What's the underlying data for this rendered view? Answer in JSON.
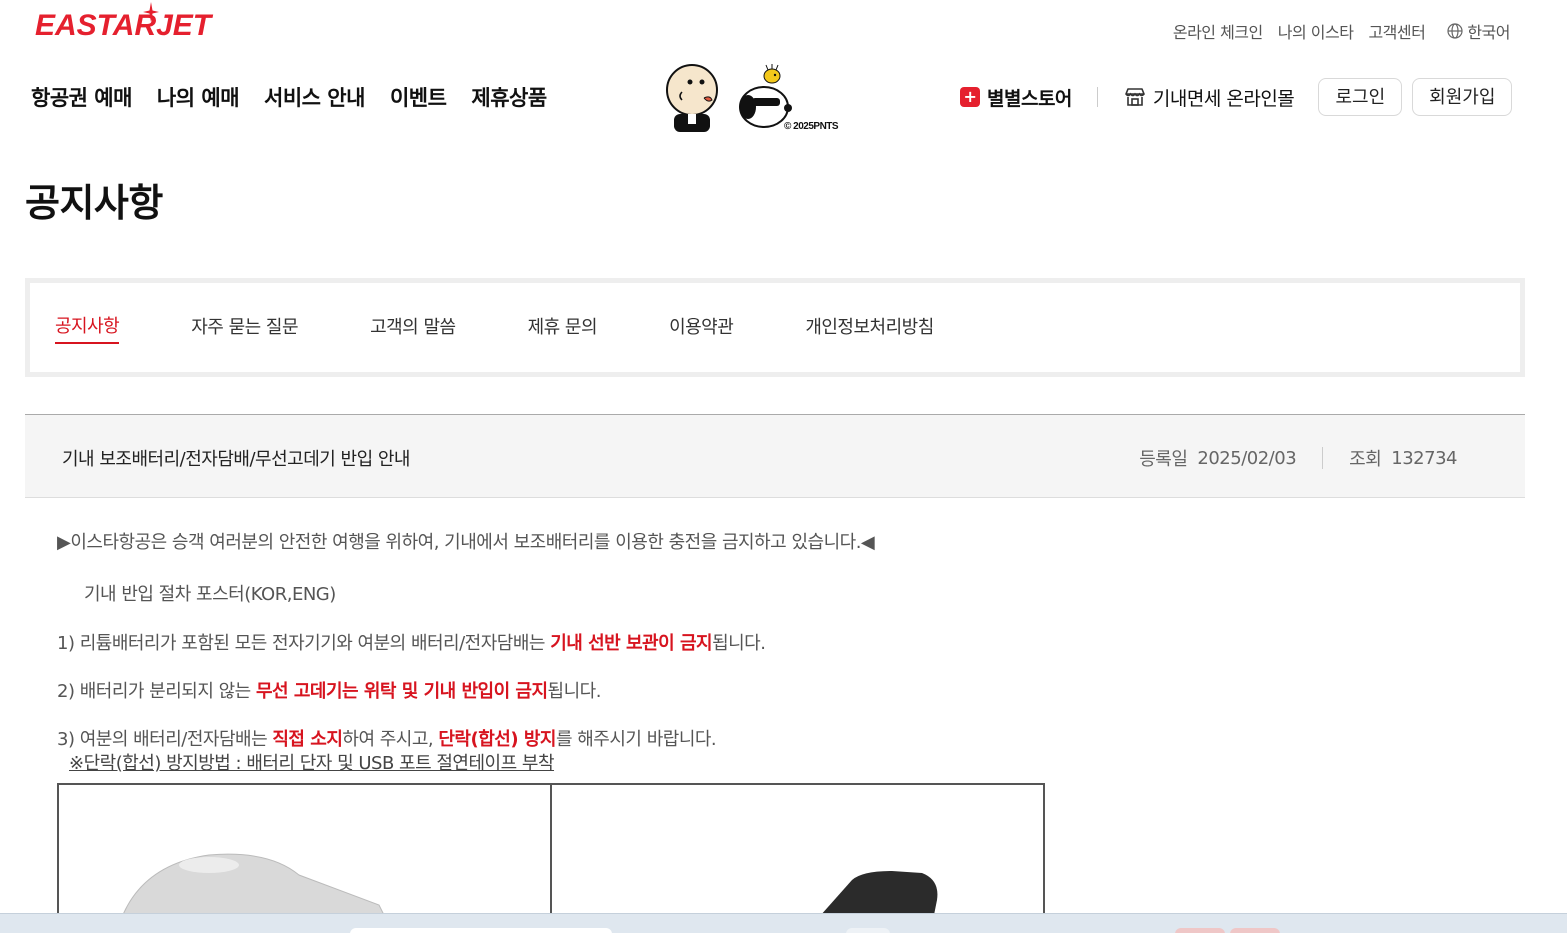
{
  "brand": {
    "logo_text": "EASTARJET",
    "accent": "#e5202e",
    "link_red": "#d7141f"
  },
  "util_nav": [
    "온라인 체크인",
    "나의 이스타",
    "고객센터"
  ],
  "language": {
    "icon": "globe-icon",
    "label": "한국어"
  },
  "gnb": [
    "항공권 예매",
    "나의 예매",
    "서비스 안내",
    "이벤트",
    "제휴상품"
  ],
  "mascot": {
    "copyright": "© 2025PNTS"
  },
  "right_nav": {
    "star_store": "별별스토어",
    "dutyfree": "기내면세 온라인몰",
    "login": "로그인",
    "join": "회원가입"
  },
  "page_title": "공지사항",
  "tabs": [
    {
      "label": "공지사항",
      "active": true
    },
    {
      "label": "자주 묻는 질문",
      "active": false
    },
    {
      "label": "고객의 말씀",
      "active": false
    },
    {
      "label": "제휴 문의",
      "active": false
    },
    {
      "label": "이용약관",
      "active": false
    },
    {
      "label": "개인정보처리방침",
      "active": false
    }
  ],
  "post": {
    "title": "기내 보조배터리/전자담배/무선고데기 반입 안내",
    "date_label": "등록일",
    "date": "2025/02/03",
    "views_label": "조회",
    "views": "132734"
  },
  "body": {
    "intro": "▶이스타항공은 승객 여러분의 안전한 여행을 위하여, 기내에서 보조배터리를 이용한 충전을 금지하고 있습니다.◀",
    "poster": "기내 반입 절차 포스터(KOR,ENG)",
    "item1_a": "1) 리튬배터리가 포함된 모든 전자기기와 여분의 배터리/전자담배는 ",
    "item1_b": "기내 선반 보관이 금지",
    "item1_c": "됩니다.",
    "item2_a": "2) 배터리가 분리되지 않는 ",
    "item2_b": "무선 고데기는 위탁 및 기내 반입이 금지",
    "item2_c": "됩니다.",
    "item3_a": "3) 여분의 배터리/전자담배는 ",
    "item3_b": "직접 소지",
    "item3_c": "하여 주시고, ",
    "item3_d": "단락(합선) 방지",
    "item3_e": "를 해주시기 바랍니다.",
    "note": "※단락(합선) 방지방법 : 배터리 단자 및 USB 포트 절연테이프 부착"
  }
}
